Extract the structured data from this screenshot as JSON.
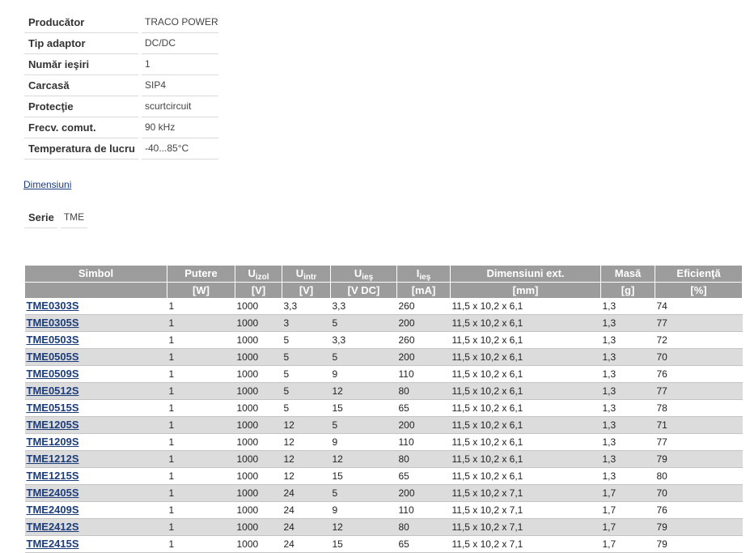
{
  "theme": {
    "header_bg": "#9c9c9c",
    "header_text": "#ffffff",
    "row_alt_bg": "#dcdcdc",
    "link_color": "#1c3d7a",
    "label_color": "#333333"
  },
  "specs": [
    {
      "label": "Producător",
      "value": "TRACO POWER"
    },
    {
      "label": "Tip adaptor",
      "value": "DC/DC"
    },
    {
      "label": "Număr ieşiri",
      "value": "1"
    },
    {
      "label": "Carcasă",
      "value": "SIP4"
    },
    {
      "label": "Protecţie",
      "value": "scurtcircuit"
    },
    {
      "label": "Frecv. comut.",
      "value": "90 kHz"
    },
    {
      "label": "Temperatura de lucru",
      "value": "-40...85°C"
    }
  ],
  "dimensions_link": "Dimensiuni",
  "series": {
    "label": "Serie",
    "value": "TME"
  },
  "products": {
    "columns": [
      {
        "label": "Simbol"
      },
      {
        "label": "Putere",
        "unit": "[W]"
      },
      {
        "label": "U",
        "sub": "izol",
        "unit": "[V]"
      },
      {
        "label": "U",
        "sub": "intr",
        "unit": "[V]"
      },
      {
        "label": "U",
        "sub": "ieş",
        "unit": "[V DC]"
      },
      {
        "label": "I",
        "sub": "ieş",
        "unit": "[mA]"
      },
      {
        "label": "Dimensiuni ext.",
        "unit": "[mm]"
      },
      {
        "label": "Masă",
        "unit": "[g]"
      },
      {
        "label": "Eficienţă",
        "unit": "[%]"
      }
    ],
    "rows": [
      [
        "TME0303S",
        "1",
        "1000",
        "3,3",
        "3,3",
        "260",
        "11,5 x 10,2 x 6,1",
        "1,3",
        "74"
      ],
      [
        "TME0305S",
        "1",
        "1000",
        "3",
        "5",
        "200",
        "11,5 x 10,2 x 6,1",
        "1,3",
        "77"
      ],
      [
        "TME0503S",
        "1",
        "1000",
        "5",
        "3,3",
        "260",
        "11,5 x 10,2 x 6,1",
        "1,3",
        "72"
      ],
      [
        "TME0505S",
        "1",
        "1000",
        "5",
        "5",
        "200",
        "11,5 x 10,2 x 6,1",
        "1,3",
        "70"
      ],
      [
        "TME0509S",
        "1",
        "1000",
        "5",
        "9",
        "110",
        "11,5 x 10,2 x 6,1",
        "1,3",
        "76"
      ],
      [
        "TME0512S",
        "1",
        "1000",
        "5",
        "12",
        "80",
        "11,5 x 10,2 x 6,1",
        "1,3",
        "77"
      ],
      [
        "TME0515S",
        "1",
        "1000",
        "5",
        "15",
        "65",
        "11,5 x 10,2 x 6,1",
        "1,3",
        "78"
      ],
      [
        "TME1205S",
        "1",
        "1000",
        "12",
        "5",
        "200",
        "11,5 x 10,2 x 6,1",
        "1,3",
        "71"
      ],
      [
        "TME1209S",
        "1",
        "1000",
        "12",
        "9",
        "110",
        "11,5 x 10,2 x 6,1",
        "1,3",
        "77"
      ],
      [
        "TME1212S",
        "1",
        "1000",
        "12",
        "12",
        "80",
        "11,5 x 10,2 x 6,1",
        "1,3",
        "79"
      ],
      [
        "TME1215S",
        "1",
        "1000",
        "12",
        "15",
        "65",
        "11,5 x 10,2 x 6,1",
        "1,3",
        "80"
      ],
      [
        "TME2405S",
        "1",
        "1000",
        "24",
        "5",
        "200",
        "11,5 x 10,2 x 7,1",
        "1,7",
        "70"
      ],
      [
        "TME2409S",
        "1",
        "1000",
        "24",
        "9",
        "110",
        "11,5 x 10,2 x 7,1",
        "1,7",
        "76"
      ],
      [
        "TME2412S",
        "1",
        "1000",
        "24",
        "12",
        "80",
        "11,5 x 10,2 x 7,1",
        "1,7",
        "79"
      ],
      [
        "TME2415S",
        "1",
        "1000",
        "24",
        "15",
        "65",
        "11,5 x 10,2 x 7,1",
        "1,7",
        "79"
      ]
    ]
  }
}
